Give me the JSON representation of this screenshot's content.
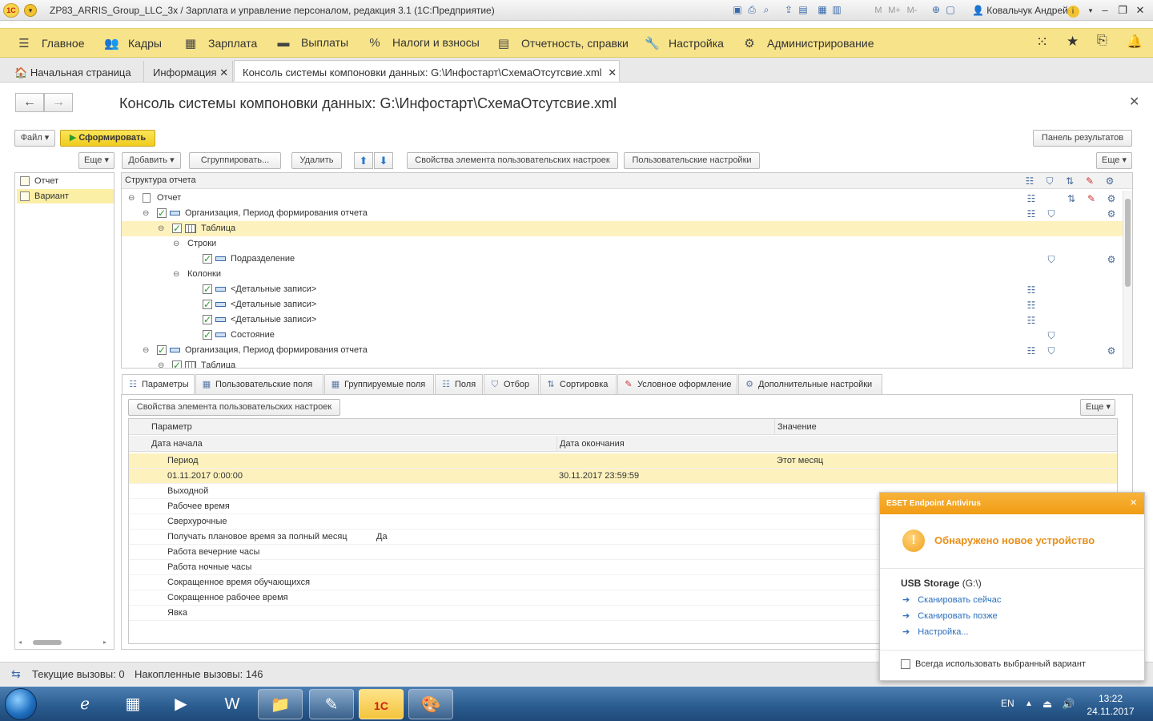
{
  "window": {
    "title": "ZP83_ARRIS_Group_LLC_3x / Зарплата и управление персоналом, редакция 3.1  (1С:Предприятие)",
    "logo_text": "1С",
    "user": "Ковальчук Андрей",
    "toolbar_text": [
      "M",
      "M+",
      "M-"
    ]
  },
  "menu": [
    {
      "label": "Главное",
      "icon": "menu-icon"
    },
    {
      "label": "Кадры",
      "icon": "people-icon"
    },
    {
      "label": "Зарплата",
      "icon": "calculator-icon"
    },
    {
      "label": "Выплаты",
      "icon": "wallet-icon"
    },
    {
      "label": "Налоги и взносы",
      "icon": "percent-icon"
    },
    {
      "label": "Отчетность, справки",
      "icon": "report-icon"
    },
    {
      "label": "Настройка",
      "icon": "wrench-icon"
    },
    {
      "label": "Администрирование",
      "icon": "gear-icon"
    }
  ],
  "tabs": {
    "home": "Начальная страница",
    "info": "Информация",
    "console": "Консоль системы компоновки данных: G:\\Инфостарт\\СхемаОтсутсвие.xml"
  },
  "form": {
    "title": "Консоль системы компоновки данных: G:\\Инфостарт\\СхемаОтсутсвие.xml",
    "file_btn": "Файл",
    "generate_btn": "Сформировать",
    "results_panel_btn": "Панель результатов",
    "more_left": "Еще",
    "add_btn": "Добавить",
    "group_btn": "Сгруппировать...",
    "delete_btn": "Удалить",
    "props_btn": "Свойства элемента пользовательских настроек",
    "user_settings_btn": "Пользовательские настройки",
    "more_right": "Еще"
  },
  "left_list": [
    "Отчет",
    "Вариант"
  ],
  "tree": {
    "header": "Структура отчета",
    "rows": [
      {
        "label": "Отчет"
      },
      {
        "label": "Организация, Период формирования отчета"
      },
      {
        "label": "Таблица"
      },
      {
        "label": "Строки"
      },
      {
        "label": "Подразделение"
      },
      {
        "label": "Колонки"
      },
      {
        "label": "<Детальные записи>"
      },
      {
        "label": "<Детальные записи>"
      },
      {
        "label": "<Детальные записи>"
      },
      {
        "label": "Состояние"
      },
      {
        "label": "Организация, Период формирования отчета"
      },
      {
        "label": "Таблица"
      }
    ]
  },
  "settings_tabs": [
    "Параметры",
    "Пользовательские поля",
    "Группируемые поля",
    "Поля",
    "Отбор",
    "Сортировка",
    "Условное оформление",
    "Дополнительные настройки"
  ],
  "params": {
    "props_btn": "Свойства элемента пользовательских настроек",
    "more_btn": "Еще",
    "col_param": "Параметр",
    "col_value": "Значение",
    "col_start": "Дата начала",
    "col_end": "Дата окончания",
    "rows": [
      {
        "name": "Период",
        "value": "Этот месяц"
      },
      {
        "name": "01.11.2017 0:00:00",
        "value": "30.11.2017 23:59:59"
      },
      {
        "name": "Выходной",
        "value": ""
      },
      {
        "name": "Рабочее время",
        "value": ""
      },
      {
        "name": "Сверхурочные",
        "value": ""
      },
      {
        "name": "Получать плановое время за полный месяц",
        "value": "Да"
      },
      {
        "name": "Работа вечерние часы",
        "value": ""
      },
      {
        "name": "Работа ночные часы",
        "value": ""
      },
      {
        "name": "Сокращенное время обучающихся",
        "value": ""
      },
      {
        "name": "Сокращенное рабочее время",
        "value": ""
      },
      {
        "name": "Явка",
        "value": ""
      }
    ]
  },
  "status": {
    "current": "Текущие вызовы: 0",
    "accumulated": "Накопленные вызовы: 146"
  },
  "eset": {
    "header": "ESET Endpoint Antivirus",
    "message": "Обнаружено новое устройство",
    "device": "USB Storage",
    "device_path": "(G:\\)",
    "links": [
      "Сканировать сейчас",
      "Сканировать позже",
      "Настройка..."
    ],
    "always": "Всегда использовать выбранный вариант"
  },
  "taskbar": {
    "lang": "EN",
    "time": "13:22",
    "date": "24.11.2017",
    "apps": [
      "ie-icon",
      "calculator-icon",
      "media-player-icon",
      "word-icon",
      "explorer-icon",
      "notes-icon",
      "1c-icon",
      "paint-icon"
    ]
  },
  "colors": {
    "menu_bg": "#f7e38a",
    "selected_row": "#fdf2bd",
    "eset_header": "#f19c14",
    "link": "#2a6ebd"
  }
}
